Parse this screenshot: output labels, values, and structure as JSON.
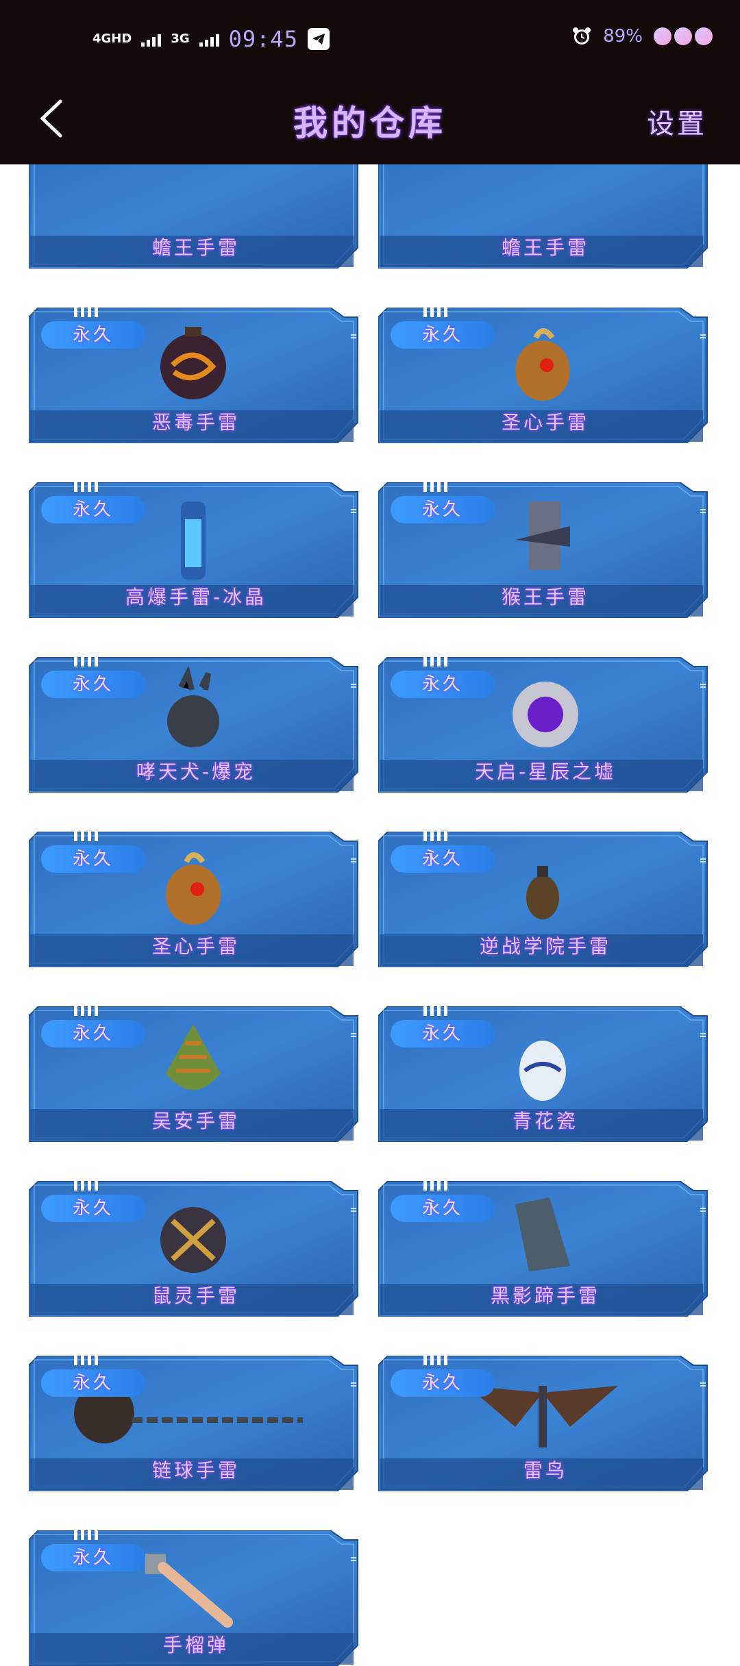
{
  "status_bar": {
    "network_left": "4GHD",
    "network_right": "3G",
    "time": "09:45",
    "battery": "89%"
  },
  "header": {
    "title": "我的仓库",
    "settings_label": "设置"
  },
  "items": [
    {
      "name": "蟾王手雷",
      "tag": ""
    },
    {
      "name": "蟾王手雷",
      "tag": ""
    },
    {
      "name": "恶毒手雷",
      "tag": "永久",
      "icon": "dark-orb-grenade-icon"
    },
    {
      "name": "圣心手雷",
      "tag": "永久",
      "icon": "heart-grenade-icon"
    },
    {
      "name": "高爆手雷-冰晶",
      "tag": "永久",
      "icon": "ice-crystal-grenade-icon"
    },
    {
      "name": "猴王手雷",
      "tag": "永久",
      "icon": "monkey-king-grenade-icon"
    },
    {
      "name": "哮天犬-爆宠",
      "tag": "永久",
      "icon": "xiaotian-dog-grenade-icon"
    },
    {
      "name": "天启-星辰之墟",
      "tag": "永久",
      "icon": "star-ruin-grenade-icon"
    },
    {
      "name": "圣心手雷",
      "tag": "永久",
      "icon": "heart-grenade-icon"
    },
    {
      "name": "逆战学院手雷",
      "tag": "永久",
      "icon": "academy-grenade-icon"
    },
    {
      "name": "吴安手雷",
      "tag": "永久",
      "icon": "pine-cone-grenade-icon"
    },
    {
      "name": "青花瓷",
      "tag": "永久",
      "icon": "blue-porcelain-grenade-icon"
    },
    {
      "name": "鼠灵手雷",
      "tag": "永久",
      "icon": "mouse-spirit-grenade-icon"
    },
    {
      "name": "黑影蹄手雷",
      "tag": "永久",
      "icon": "black-hoof-grenade-icon"
    },
    {
      "name": "链球手雷",
      "tag": "永久",
      "icon": "chain-ball-grenade-icon"
    },
    {
      "name": "雷鸟",
      "tag": "永久",
      "icon": "thunderbird-grenade-icon"
    },
    {
      "name": "手榴弹",
      "tag": "永久",
      "icon": "stick-grenade-icon"
    }
  ]
}
